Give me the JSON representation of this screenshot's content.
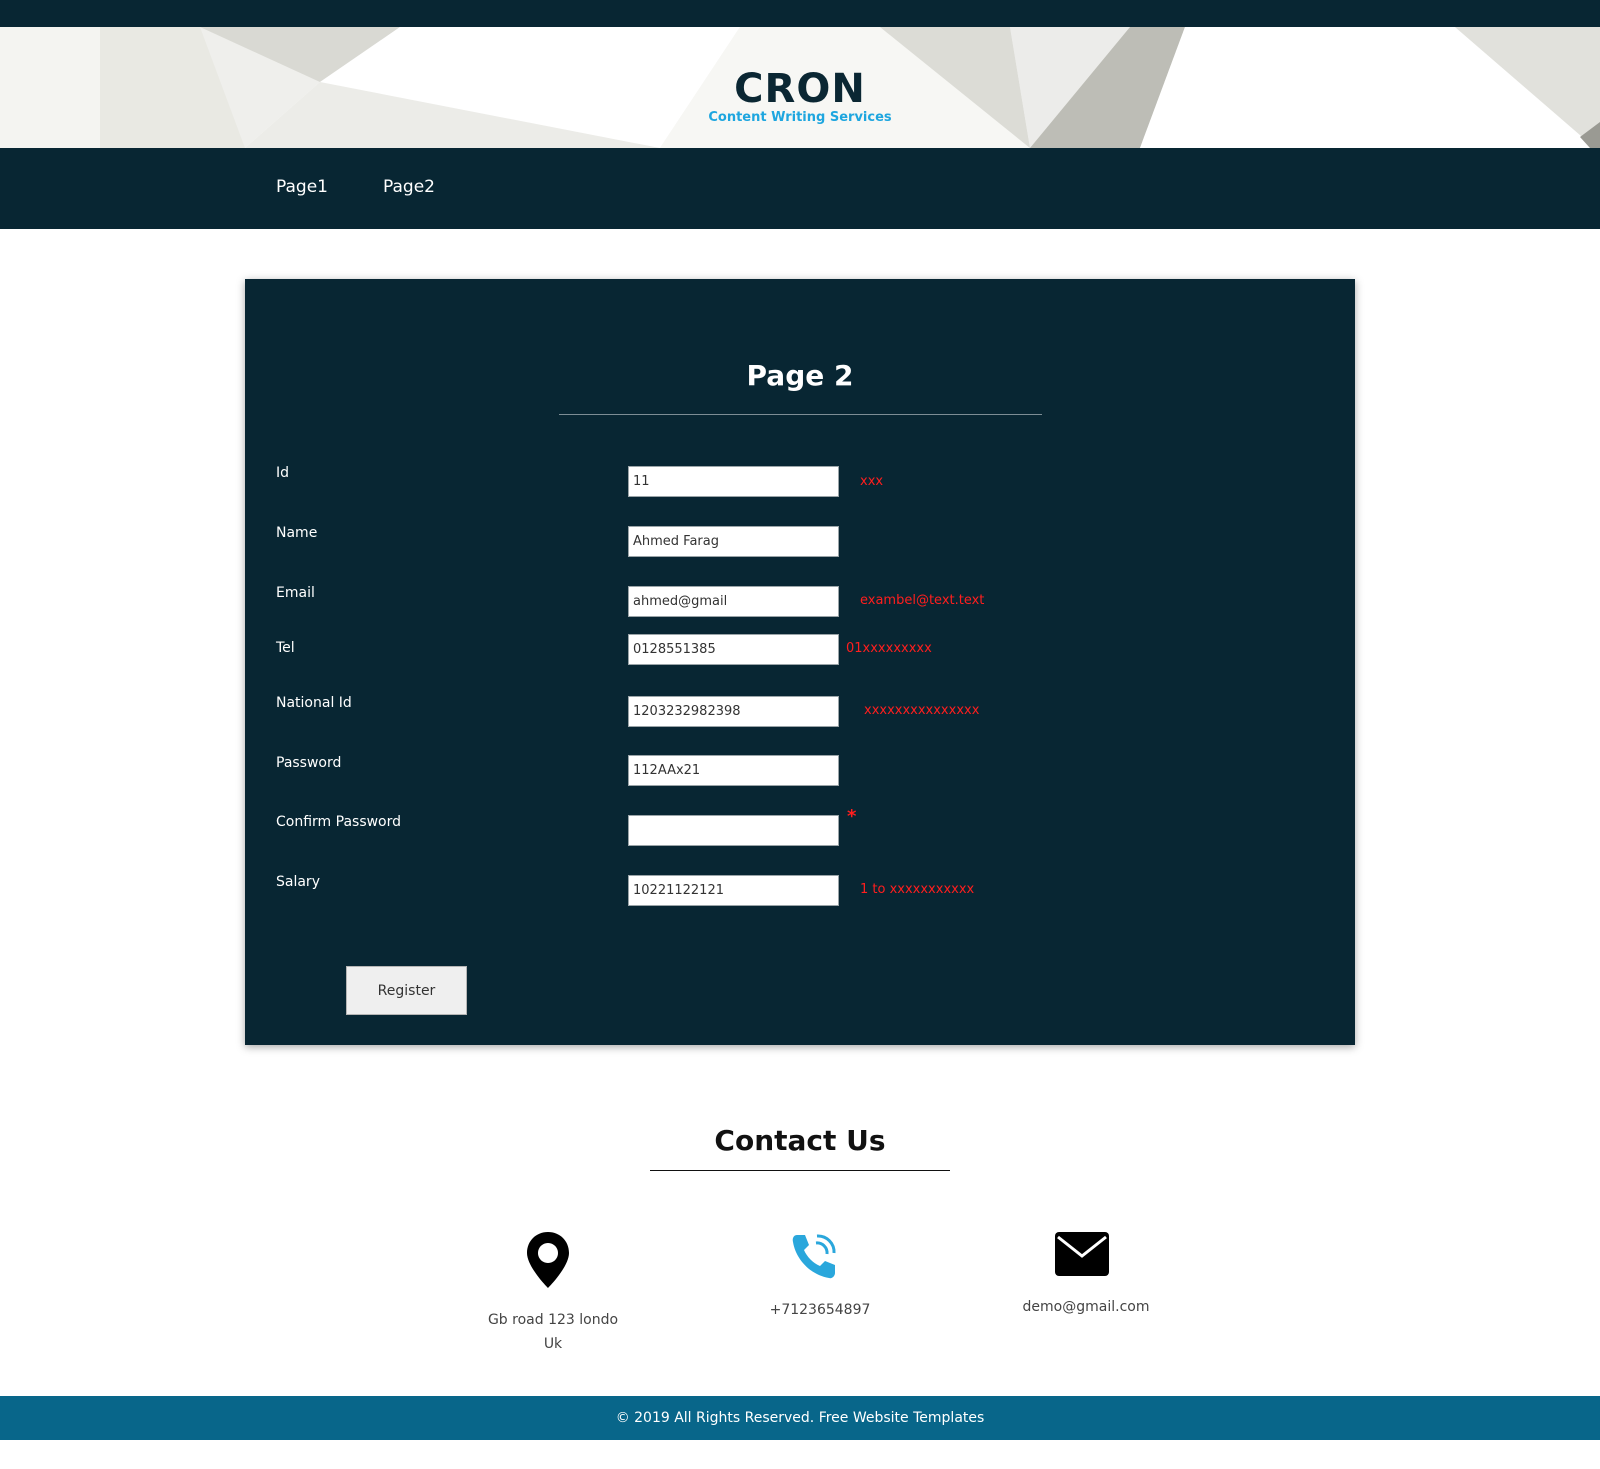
{
  "header": {
    "brand_title": "CRON",
    "brand_subtitle": "Content Writing Services"
  },
  "nav": {
    "items": [
      {
        "label": "Page1"
      },
      {
        "label": "Page2"
      }
    ]
  },
  "form": {
    "title": "Page 2",
    "fields": [
      {
        "label": "Id",
        "value": "11",
        "hint": "xxx"
      },
      {
        "label": "Name",
        "value": "Ahmed Farag",
        "hint": ""
      },
      {
        "label": "Email",
        "value": "ahmed@gmail",
        "hint": "exambel@text.text"
      },
      {
        "label": "Tel",
        "value": "0128551385",
        "hint": "01xxxxxxxxx"
      },
      {
        "label": "National Id",
        "value": "1203232982398",
        "hint": "xxxxxxxxxxxxxxx"
      },
      {
        "label": "Password",
        "value": "112AAx21",
        "hint": ""
      },
      {
        "label": "Confirm Password",
        "value": "",
        "hint": "*"
      },
      {
        "label": "Salary",
        "value": "10221122121",
        "hint": "1 to xxxxxxxxxxx"
      }
    ],
    "submit_label": "Register"
  },
  "contact": {
    "title": "Contact Us",
    "address_line1": "Gb road 123 londo",
    "address_line2": "Uk",
    "phone": "+7123654897",
    "email": "demo@gmail.com"
  },
  "footer": {
    "text": "© 2019 All Rights Reserved. Free Website Templates"
  },
  "colors": {
    "navy": "#082633",
    "accent_blue": "#1ea6df",
    "footer_blue": "#08668a",
    "hint_red": "#ff1e1e"
  },
  "icons": {
    "address": "map-pin-icon",
    "phone": "phone-icon",
    "email": "envelope-icon"
  }
}
